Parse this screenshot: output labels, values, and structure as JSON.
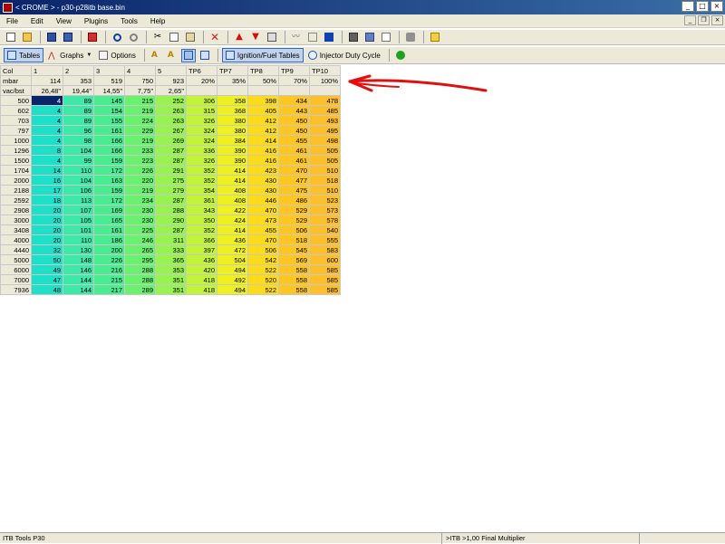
{
  "window": {
    "title": "< CROME > - p30-p28itb base.bin"
  },
  "menu": [
    "File",
    "Edit",
    "View",
    "Plugins",
    "Tools",
    "Help"
  ],
  "toolbar2": {
    "tables": "Tables",
    "graphs": "Graphs",
    "options": "Options",
    "ign_fuel": "Ignition/Fuel Tables",
    "inj_duty": "Injector Duty Cycle"
  },
  "table": {
    "col_header": {
      "label": "Col",
      "values": [
        "1",
        "2",
        "3",
        "4",
        "5",
        "TP6",
        "TP7",
        "TP8",
        "TP9",
        "TP10"
      ]
    },
    "mbar": {
      "label": "mbar",
      "values": [
        "114",
        "353",
        "519",
        "750",
        "923",
        "20%",
        "35%",
        "50%",
        "70%",
        "100%"
      ]
    },
    "vac": {
      "label": "vac/bst",
      "values": [
        "26,48\"",
        "19,44\"",
        "14,55\"",
        "7,75\"",
        "2,65\"",
        "",
        "",
        "",
        "",
        ""
      ]
    },
    "rows": [
      {
        "rpm": "500",
        "v": [
          4,
          89,
          145,
          215,
          252,
          306,
          358,
          398,
          434,
          478
        ]
      },
      {
        "rpm": "602",
        "v": [
          4,
          89,
          154,
          219,
          263,
          315,
          368,
          405,
          443,
          485
        ]
      },
      {
        "rpm": "703",
        "v": [
          4,
          89,
          155,
          224,
          263,
          326,
          380,
          412,
          450,
          493
        ]
      },
      {
        "rpm": "797",
        "v": [
          4,
          96,
          161,
          229,
          267,
          324,
          380,
          412,
          450,
          495
        ]
      },
      {
        "rpm": "1000",
        "v": [
          4,
          98,
          166,
          219,
          269,
          324,
          384,
          414,
          455,
          498
        ]
      },
      {
        "rpm": "1296",
        "v": [
          8,
          104,
          166,
          233,
          287,
          336,
          390,
          416,
          461,
          505
        ]
      },
      {
        "rpm": "1500",
        "v": [
          4,
          99,
          159,
          223,
          287,
          326,
          390,
          416,
          461,
          505
        ]
      },
      {
        "rpm": "1704",
        "v": [
          14,
          110,
          172,
          226,
          291,
          352,
          414,
          423,
          470,
          510
        ]
      },
      {
        "rpm": "2000",
        "v": [
          16,
          104,
          163,
          220,
          275,
          352,
          414,
          430,
          477,
          518
        ]
      },
      {
        "rpm": "2188",
        "v": [
          17,
          106,
          159,
          219,
          279,
          354,
          408,
          430,
          475,
          510
        ]
      },
      {
        "rpm": "2592",
        "v": [
          18,
          113,
          172,
          234,
          287,
          361,
          408,
          446,
          486,
          523
        ]
      },
      {
        "rpm": "2908",
        "v": [
          20,
          107,
          169,
          230,
          288,
          343,
          422,
          470,
          529,
          573
        ]
      },
      {
        "rpm": "3000",
        "v": [
          20,
          105,
          165,
          230,
          290,
          350,
          424,
          473,
          529,
          578
        ]
      },
      {
        "rpm": "3408",
        "v": [
          20,
          101,
          161,
          225,
          287,
          352,
          414,
          455,
          506,
          540
        ]
      },
      {
        "rpm": "4000",
        "v": [
          20,
          110,
          186,
          246,
          311,
          366,
          436,
          470,
          518,
          555
        ]
      },
      {
        "rpm": "4440",
        "v": [
          32,
          130,
          200,
          265,
          333,
          397,
          472,
          506,
          545,
          583
        ]
      },
      {
        "rpm": "5000",
        "v": [
          50,
          148,
          226,
          295,
          365,
          436,
          504,
          542,
          569,
          600
        ]
      },
      {
        "rpm": "6000",
        "v": [
          49,
          146,
          216,
          288,
          353,
          420,
          494,
          522,
          558,
          585
        ]
      },
      {
        "rpm": "7000",
        "v": [
          47,
          144,
          215,
          288,
          351,
          418,
          492,
          520,
          558,
          585
        ]
      },
      {
        "rpm": "7936",
        "v": [
          48,
          144,
          217,
          289,
          351,
          418,
          494,
          522,
          558,
          585
        ]
      }
    ]
  },
  "column_colors": [
    "#1ee0c8",
    "#3ee8a8",
    "#4aec92",
    "#6cf070",
    "#98f250",
    "#c4f43a",
    "#eef020",
    "#fcdc1a",
    "#fdc622",
    "#fcc02c"
  ],
  "status": {
    "left": "ITB Tools P30",
    "right": ">ITB >1,00 Final Multiplier"
  }
}
